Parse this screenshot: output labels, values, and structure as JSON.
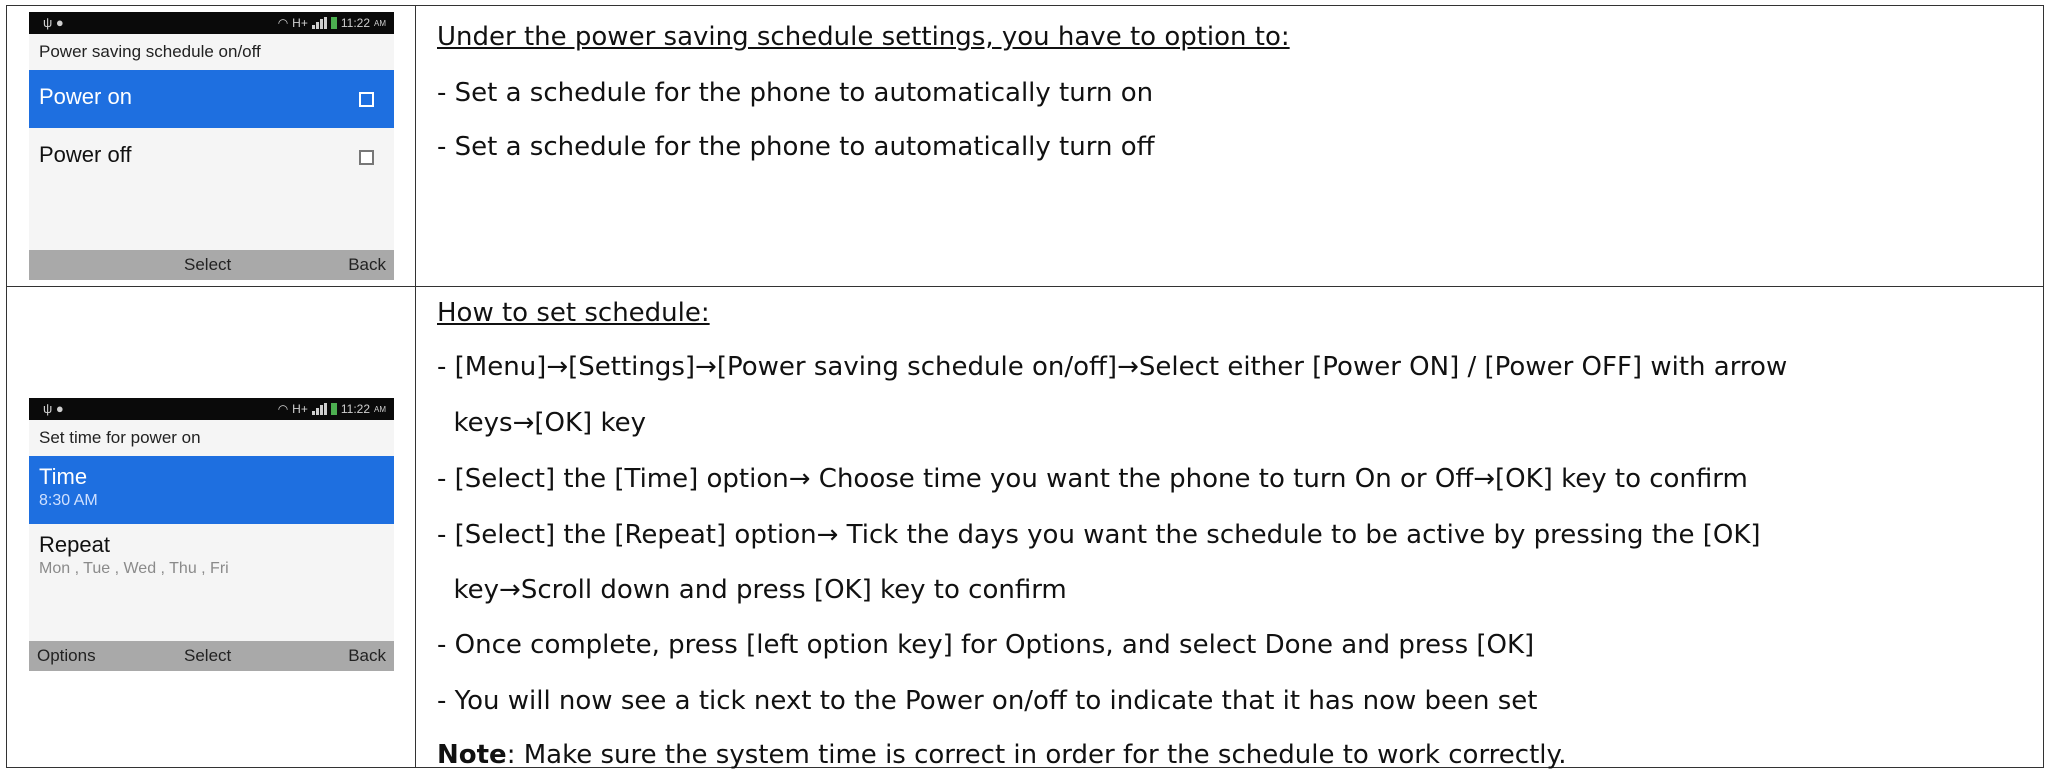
{
  "phone1": {
    "status_time": "11:22",
    "status_ampm": "AM",
    "status_network": "H+",
    "title": "Power saving schedule on/off",
    "items": [
      {
        "label": "Power on"
      },
      {
        "label": "Power off"
      }
    ],
    "softkeys": {
      "center": "Select",
      "right": "Back"
    }
  },
  "phone2": {
    "status_time": "11:22",
    "status_ampm": "AM",
    "status_network": "H+",
    "title": "Set time for power on",
    "items": [
      {
        "label": "Time",
        "sub": "8:30 AM"
      },
      {
        "label": "Repeat",
        "sub": "Mon , Tue , Wed , Thu , Fri"
      }
    ],
    "softkeys": {
      "left": "Options",
      "center": "Select",
      "right": "Back"
    }
  },
  "section1": {
    "heading": "Under the power saving schedule settings, you have to option to:",
    "lines": [
      "- Set a schedule for the phone to automatically turn on",
      "- Set a schedule for the phone to automatically turn off"
    ]
  },
  "section2": {
    "heading": "How to set schedule:",
    "lines": [
      "- [Menu]→[Settings]→[Power saving schedule on/off]→Select either [Power ON] / [Power OFF] with arrow",
      "  keys→[OK] key",
      "- [Select] the [Time] option→ Choose time you want the phone to turn On or Off→[OK] key to confirm",
      "- [Select] the [Repeat] option→ Tick the days you want the schedule to be active by pressing the [OK]",
      "  key→Scroll down and press [OK] key to confirm",
      "- Once complete, press [left option key] for Options, and select Done and press [OK]",
      "- You will now see a tick next to the Power on/off to indicate that it has now been set"
    ],
    "note_label": "Note",
    "note_text": ": Make sure the system time is correct in order for the schedule to work correctly."
  }
}
